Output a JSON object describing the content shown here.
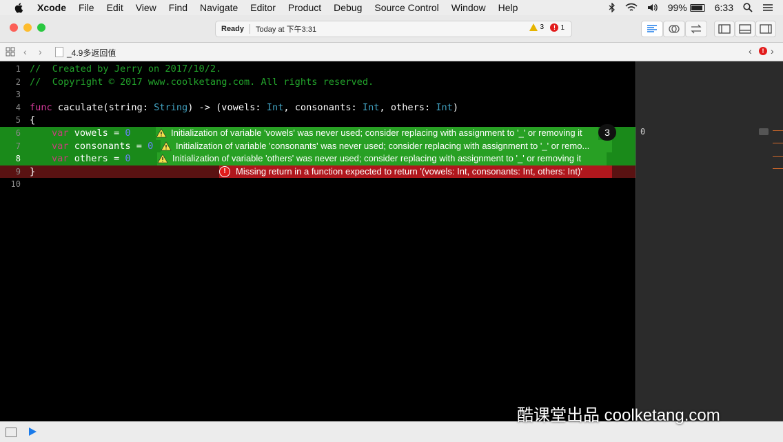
{
  "menubar": {
    "app_name": "Xcode",
    "items": [
      "File",
      "Edit",
      "View",
      "Find",
      "Navigate",
      "Editor",
      "Product",
      "Debug",
      "Source Control",
      "Window",
      "Help"
    ],
    "battery": "99%",
    "time": "6:33"
  },
  "toolbar": {
    "status": "Ready",
    "timestamp": "Today at 下午3:31",
    "warning_count": "3",
    "error_count": "1"
  },
  "jumpbar": {
    "file_name": "_4.9多返回值"
  },
  "editor": {
    "line_numbers": [
      "1",
      "2",
      "3",
      "4",
      "5",
      "6",
      "7",
      "8",
      "9",
      "10"
    ],
    "lines": {
      "l1": "//  Created by Jerry on 2017/10/2.",
      "l2": "//  Copyright © 2017 www.coolketang.com. All rights reserved.",
      "l4_func": "func",
      "l4_name": " caculate(string: ",
      "l4_t1": "String",
      "l4_mid": ") -> (vowels: ",
      "l4_t2": "Int",
      "l4_mid2": ", consonants: ",
      "l4_t3": "Int",
      "l4_mid3": ", others: ",
      "l4_t4": "Int",
      "l4_end": ")",
      "l5": "{",
      "var_kw": "var",
      "l6_name": " vowels = ",
      "l7_name": " consonants = ",
      "l8_name": " others = ",
      "zero": "0",
      "l9": "}"
    },
    "issues": {
      "w1": "Initialization of variable 'vowels' was never used; consider replacing with assignment to '_' or removing it",
      "w2": "Initialization of variable 'consonants' was never used; consider replacing with assignment to '_' or remo...",
      "w3": "Initialization of variable 'others' was never used; consider replacing with assignment to '_' or removing it",
      "e1": "Missing return in a function expected to return '(vowels: Int, consonants: Int, others: Int)'"
    },
    "issue_group_count": "3"
  },
  "results_panel": {
    "value": "0"
  },
  "watermark": "酷课堂出品 coolketang.com",
  "colors": {
    "comment": "#22a32b",
    "keyword": "#d93b9e",
    "type": "#41a1c0",
    "warning_bg": "#1a8a1a",
    "error_bg": "#5a1212"
  }
}
